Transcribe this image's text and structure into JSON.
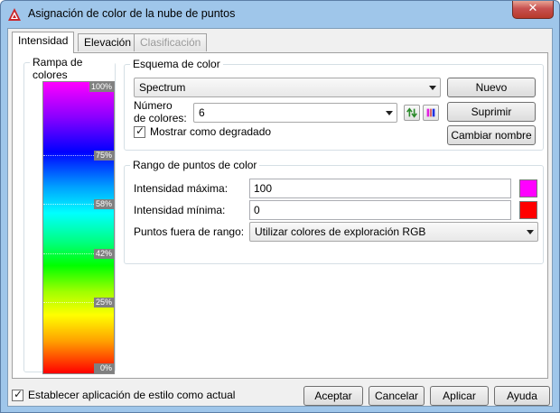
{
  "window": {
    "title": "Asignación de color de la nube de puntos",
    "close_symbol": "✕"
  },
  "tabs": [
    {
      "label": "Intensidad",
      "active": true
    },
    {
      "label": "Elevación",
      "active": false
    },
    {
      "label": "Clasificación",
      "active": false,
      "disabled": true
    }
  ],
  "ramp": {
    "title": "Rampa de colores",
    "ticks": [
      "100%",
      "75%",
      "58%",
      "42%",
      "25%",
      "0%"
    ],
    "colors": [
      "#ff00ff",
      "#0000ff",
      "#00ffff",
      "#00ff00",
      "#ffff00",
      "#ff0000"
    ]
  },
  "scheme": {
    "group_label": "Esquema de color",
    "selected": "Spectrum",
    "num_colors_label_1": "Número",
    "num_colors_label_2": "de colores:",
    "num_colors_value": "6",
    "show_gradient_label": "Mostrar como degradado",
    "show_gradient_checked": true,
    "buttons": {
      "new": "Nuevo",
      "delete": "Suprimir",
      "rename": "Cambiar nombre"
    }
  },
  "range": {
    "group_label": "Rango de puntos de color",
    "max_label": "Intensidad máxima:",
    "max_value": "100",
    "max_color": "#ff00ff",
    "min_label": "Intensidad mínima:",
    "min_value": "0",
    "min_color": "#ff0000",
    "outside_label": "Puntos fuera de rango:",
    "outside_value": "Utilizar colores de exploración RGB"
  },
  "footer": {
    "set_current_label": "Establecer aplicación de estilo como actual",
    "set_current_checked": true,
    "accept": "Aceptar",
    "cancel": "Cancelar",
    "apply": "Aplicar",
    "help": "Ayuda"
  }
}
